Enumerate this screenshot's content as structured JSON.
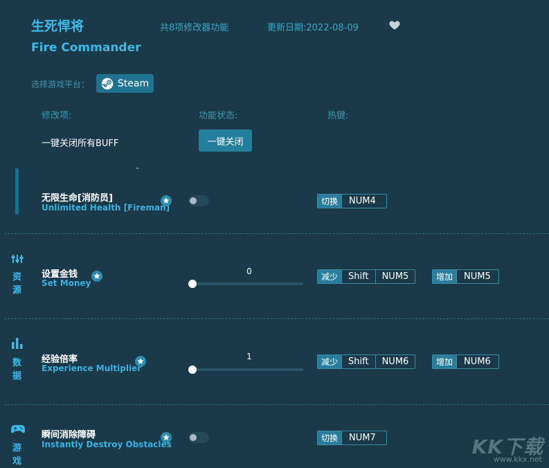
{
  "header": {
    "title_cn": "生死悍将",
    "title_en": "Fire Commander",
    "feature_count": "共8项修改器功能",
    "update_date": "更新日期:2022-08-09"
  },
  "platform": {
    "label": "选择游戏平台：",
    "button": "Steam"
  },
  "columns": {
    "item": "修改项:",
    "status": "功能状态:",
    "hotkey": "热键:"
  },
  "all_buff": {
    "label": "一键关闭所有BUFF",
    "button": "一键关闭"
  },
  "categories": {
    "resource": {
      "line1": "资",
      "line2": "源"
    },
    "data": {
      "line1": "数",
      "line2": "据"
    },
    "game": {
      "line1": "游",
      "line2": "戏"
    }
  },
  "items": [
    {
      "cn": "无限生命[消防员]",
      "en": "Unlimited Health [Fireman]",
      "tag": "切换",
      "keys": [
        "NUM4"
      ]
    },
    {
      "cn": "设置金钱",
      "en": "Set Money",
      "value": "0",
      "slider_fraction": 0,
      "dec_tag": "减少",
      "dec_keys": [
        "Shift",
        "NUM5"
      ],
      "inc_tag": "增加",
      "inc_keys": [
        "NUM5"
      ]
    },
    {
      "cn": "经验倍率",
      "en": "Experience Multiplier",
      "value": "1",
      "slider_fraction": 0,
      "dec_tag": "减少",
      "dec_keys": [
        "Shift",
        "NUM6"
      ],
      "inc_tag": "增加",
      "inc_keys": [
        "NUM6"
      ]
    },
    {
      "cn": "瞬间消除障碍",
      "en": "Instantly Destroy Obstacles",
      "tag": "切换",
      "keys": [
        "NUM7"
      ]
    }
  ],
  "watermark": {
    "brand": "KK下载",
    "url": "www.kkx.net"
  },
  "colors": {
    "background": "#1a3a4a",
    "accent": "#40b8e8",
    "button": "#247f9c"
  },
  "icons": [
    "heart-icon",
    "steam-icon",
    "star-icon",
    "sliders-icon",
    "bar-chart-icon",
    "gamepad-icon"
  ]
}
